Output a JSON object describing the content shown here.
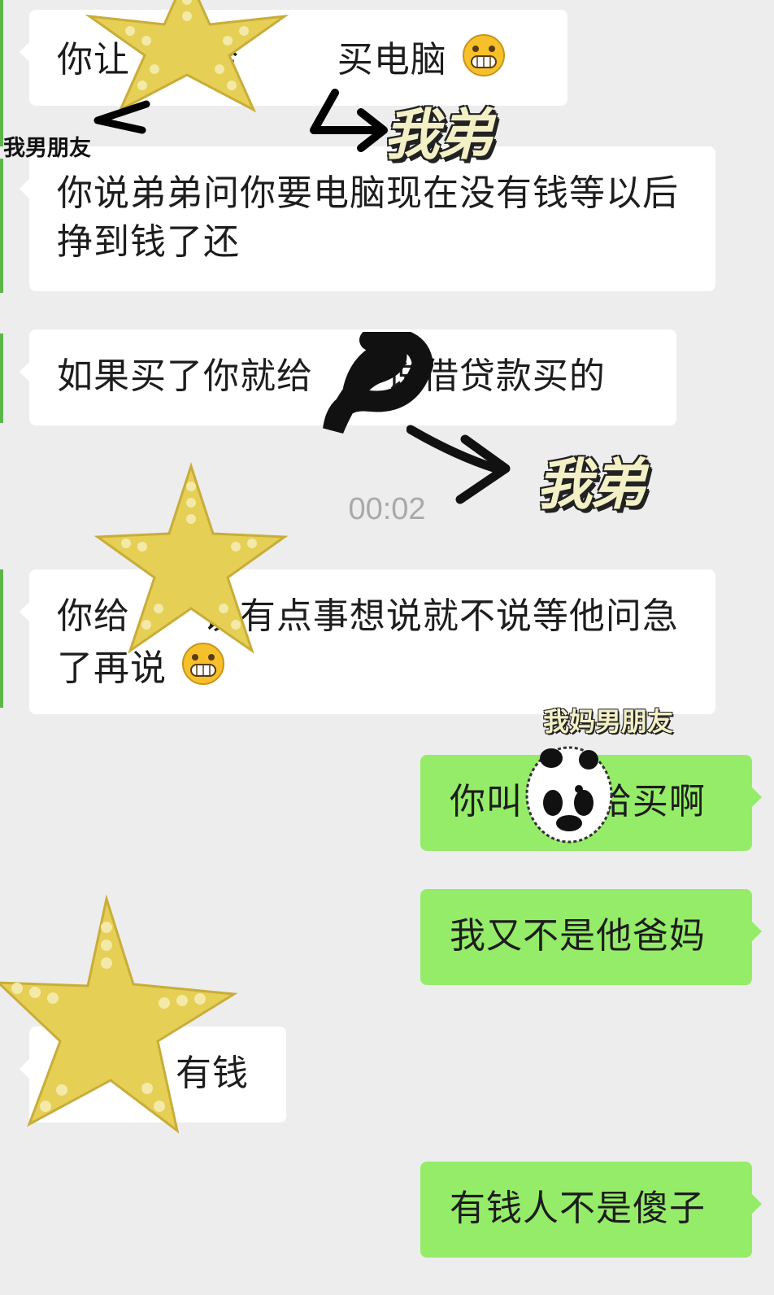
{
  "messages": [
    {
      "side": "in",
      "text": "你让      给        买电脑",
      "emoji": "grin-emoji"
    },
    {
      "side": "in",
      "text": "你说弟弟问你要电脑现在没有钱等以后挣到钱了还"
    },
    {
      "side": "in",
      "text": "如果买了你就给      说借贷款买的"
    },
    {
      "side": "in",
      "text": "你给      说有点事想说就不说等他问急了再说",
      "emoji": "grin-emoji"
    },
    {
      "side": "out",
      "text": "你叫      给买啊"
    },
    {
      "side": "out",
      "text": "我又不是他爸妈"
    },
    {
      "side": "in",
      "text": "有钱"
    },
    {
      "side": "out",
      "text": "有钱人不是傻子"
    }
  ],
  "timestamp": "00:02",
  "annotations": {
    "boyfriend": "我男朋友",
    "brother_1": "我弟",
    "brother_2": "我弟",
    "mom_boyfriend": "我妈男朋友"
  },
  "colors": {
    "background": "#ededed",
    "incoming_bubble": "#ffffff",
    "outgoing_bubble": "#95ec69",
    "star_sticker": "#e6cf55"
  }
}
